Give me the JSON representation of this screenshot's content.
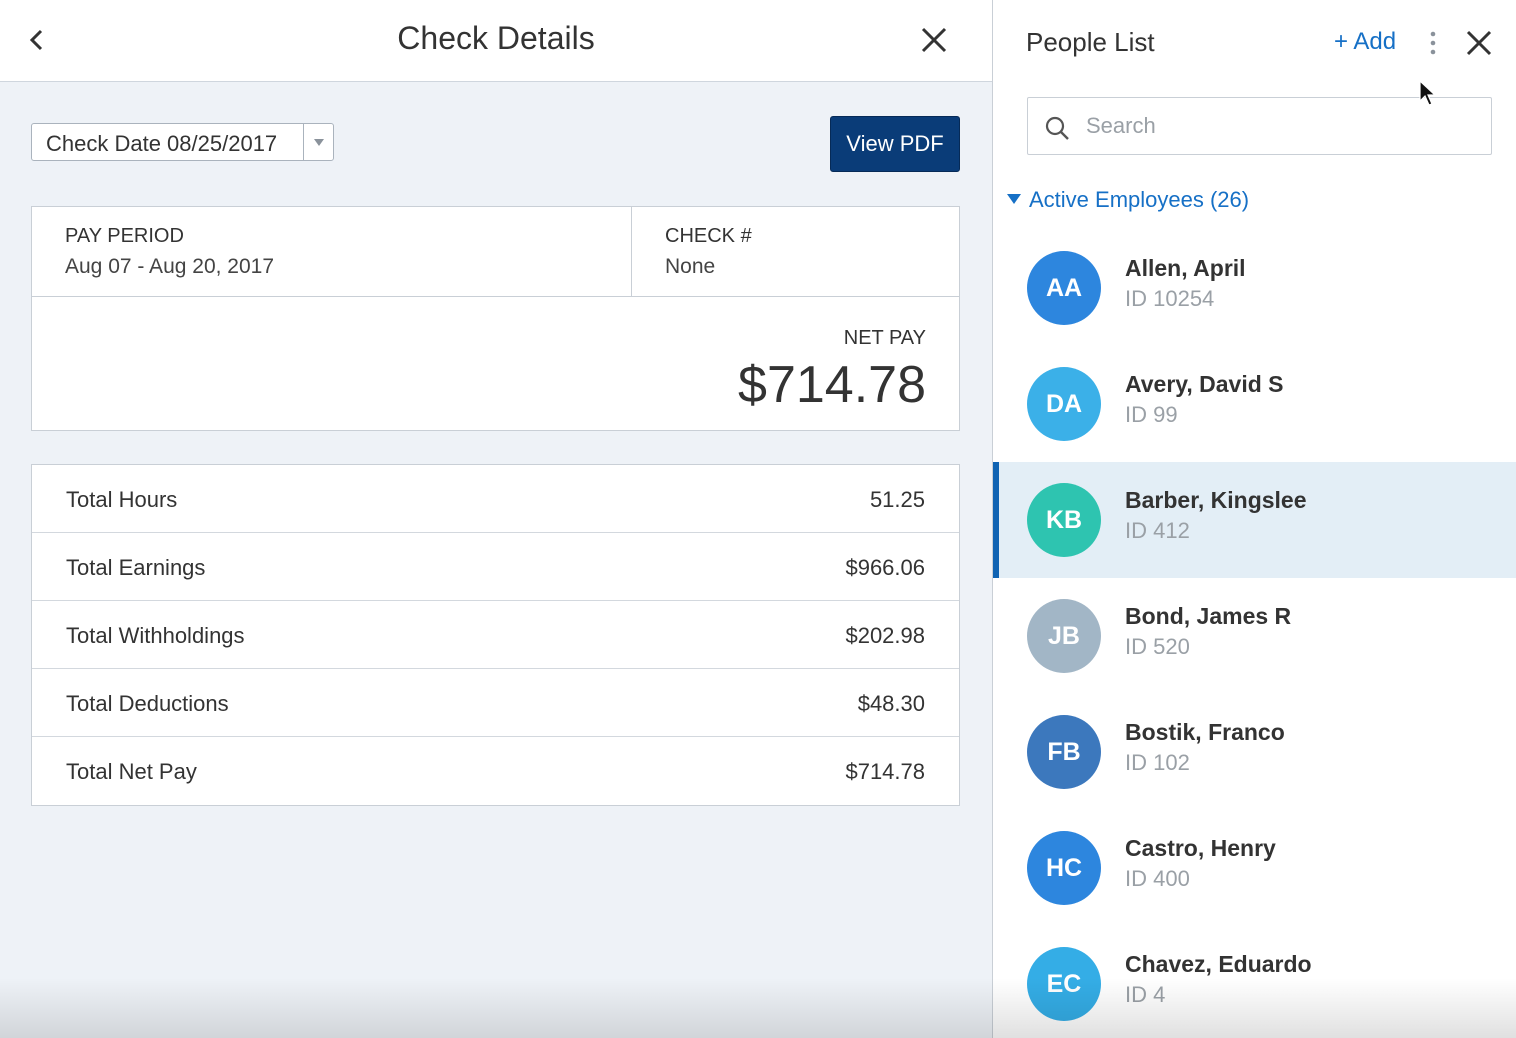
{
  "check_details": {
    "title": "Check Details",
    "check_date": "Check Date 08/25/2017",
    "view_pdf_label": "View PDF",
    "pay_period_label": "PAY PERIOD",
    "pay_period_value": "Aug 07 - Aug 20, 2017",
    "check_num_label": "CHECK #",
    "check_num_value": "None",
    "net_pay_label": "NET PAY",
    "net_pay_value": "$714.78",
    "totals": [
      {
        "label": "Total Hours",
        "value": "51.25"
      },
      {
        "label": "Total Earnings",
        "value": "$966.06"
      },
      {
        "label": "Total Withholdings",
        "value": "$202.98"
      },
      {
        "label": "Total Deductions",
        "value": "$48.30"
      },
      {
        "label": "Total Net Pay",
        "value": "$714.78"
      }
    ]
  },
  "people_list": {
    "title": "People List",
    "add_label": "+ Add",
    "search_placeholder": "Search",
    "group_label": "Active Employees",
    "group_count": "(26)",
    "employees": [
      {
        "initials": "AA",
        "name": "Allen, April",
        "id": "ID 10254",
        "color": "#2d86de"
      },
      {
        "initials": "DA",
        "name": "Avery, David S",
        "id": "ID 99",
        "color": "#3bb0e8"
      },
      {
        "initials": "KB",
        "name": "Barber, Kingslee",
        "id": "ID 412",
        "color": "#2ec4b0",
        "selected": true
      },
      {
        "initials": "JB",
        "name": "Bond, James R",
        "id": "ID 520",
        "color": "#a2b6c6"
      },
      {
        "initials": "FB",
        "name": "Bostik, Franco",
        "id": "ID 102",
        "color": "#3c78bd"
      },
      {
        "initials": "HC",
        "name": "Castro, Henry",
        "id": "ID 400",
        "color": "#2d86de"
      },
      {
        "initials": "EC",
        "name": "Chavez, Eduardo",
        "id": "ID 4",
        "color": "#34ade6"
      }
    ]
  }
}
